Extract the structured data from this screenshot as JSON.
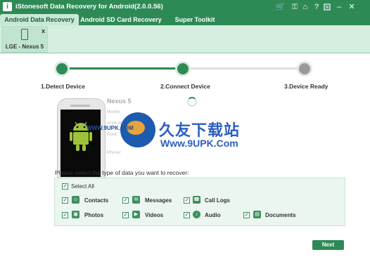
{
  "window": {
    "title": "iStonesoft Data Recovery for Android(2.0.0.56)",
    "logo_glyph": "i",
    "controls": {
      "cart": "🛒",
      "key": "⚿",
      "home": "⌂",
      "help": "?",
      "minimize": "–",
      "close": "✕"
    }
  },
  "tabs": [
    {
      "label": "Android Data Recovery",
      "active": true
    },
    {
      "label": "Android SD Card Recovery",
      "active": false
    },
    {
      "label": "Super Toolkit",
      "active": false
    }
  ],
  "device": {
    "label": "LGE - Nexus 5",
    "close": "x"
  },
  "steps": [
    {
      "label": "1.Detect Device",
      "state": "done"
    },
    {
      "label": "2.Connect Device",
      "state": "current"
    },
    {
      "label": "3.Device Ready",
      "state": "pending"
    }
  ],
  "phone_info": {
    "name": "Nexus 5",
    "meta": [
      "Model:",
      "Android:",
      "Root:",
      "Phone:"
    ]
  },
  "watermark": {
    "small": "WWW.9UPK.COM",
    "cn": "久友下载站",
    "url": "Www.9UPK.Com"
  },
  "prompt": "Please select the type of data you want to recover:",
  "select_all": {
    "label": "Select All",
    "checked": true
  },
  "data_types": [
    {
      "label": "Contacts",
      "icon": "contacts-icon",
      "glyph": "☺",
      "checked": true
    },
    {
      "label": "Messages",
      "icon": "messages-icon",
      "glyph": "✉",
      "checked": true
    },
    {
      "label": "Call Logs",
      "icon": "call-logs-icon",
      "glyph": "☎",
      "checked": true
    },
    {
      "label": "Photos",
      "icon": "photos-icon",
      "glyph": "▣",
      "checked": true
    },
    {
      "label": "Videos",
      "icon": "videos-icon",
      "glyph": "▶",
      "checked": true
    },
    {
      "label": "Audio",
      "icon": "audio-icon",
      "glyph": "♪",
      "checked": true
    },
    {
      "label": "Documents",
      "icon": "documents-icon",
      "glyph": "▤",
      "checked": true
    }
  ],
  "check_glyph": "✓",
  "next_button": "Next",
  "colors": {
    "accent": "#2e8a55",
    "pending": "#9a9a9a",
    "strip": "#d5eee0",
    "box": "#eaf6ef"
  }
}
